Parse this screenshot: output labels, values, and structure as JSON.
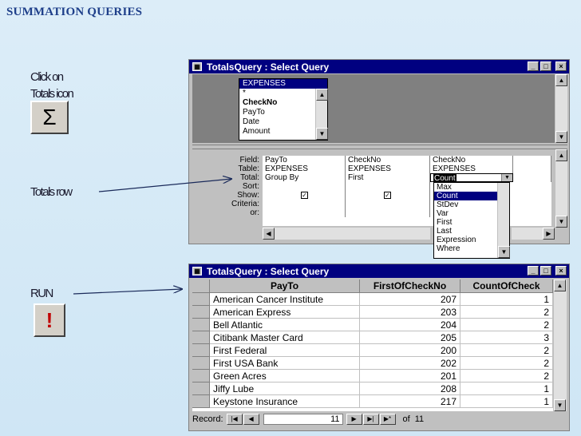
{
  "slide": {
    "title": "SUMMATION QUERIES",
    "caption_totals": [
      "Click on",
      "Totals icon"
    ],
    "caption_row": "Totals row",
    "caption_run": "RUN",
    "sigma_glyph": "Σ",
    "run_glyph": "!"
  },
  "design_window": {
    "title": "TotalsQuery : Select Query",
    "field_list": {
      "table": "EXPENSES",
      "fields": [
        "*",
        "CheckNo",
        "PayTo",
        "Date",
        "Amount"
      ]
    },
    "row_labels": [
      "Field:",
      "Table:",
      "Total:",
      "Sort:",
      "Show:",
      "Criteria:",
      "or:"
    ],
    "columns": [
      {
        "field": "PayTo",
        "table": "EXPENSES",
        "total": "Group By"
      },
      {
        "field": "CheckNo",
        "table": "EXPENSES",
        "total": "First"
      },
      {
        "field": "CheckNo",
        "table": "EXPENSES",
        "total": "Count"
      }
    ],
    "total_options": [
      "Max",
      "Count",
      "StDev",
      "Var",
      "First",
      "Last",
      "Expression",
      "Where"
    ],
    "selected_option": "Count"
  },
  "datasheet_window": {
    "title": "TotalsQuery : Select Query",
    "headers": [
      "PayTo",
      "FirstOfCheckNo",
      "CountOfCheck"
    ],
    "rows": [
      [
        "American Cancer Institute",
        "207",
        "1"
      ],
      [
        "American Express",
        "203",
        "2"
      ],
      [
        "Bell Atlantic",
        "204",
        "2"
      ],
      [
        "Citibank Master Card",
        "205",
        "3"
      ],
      [
        "First Federal",
        "200",
        "2"
      ],
      [
        "First USA Bank",
        "202",
        "2"
      ],
      [
        "Green Acres",
        "201",
        "2"
      ],
      [
        "Jiffy Lube",
        "208",
        "1"
      ],
      [
        "Keystone Insurance",
        "217",
        "1"
      ]
    ],
    "record_label": "Record:",
    "record_current": "11",
    "record_of": "of",
    "record_total": "11"
  },
  "colors": {
    "titlebar": "#000080",
    "caption_accent": "#8b0000",
    "slide_title": "#1e3f8a"
  }
}
